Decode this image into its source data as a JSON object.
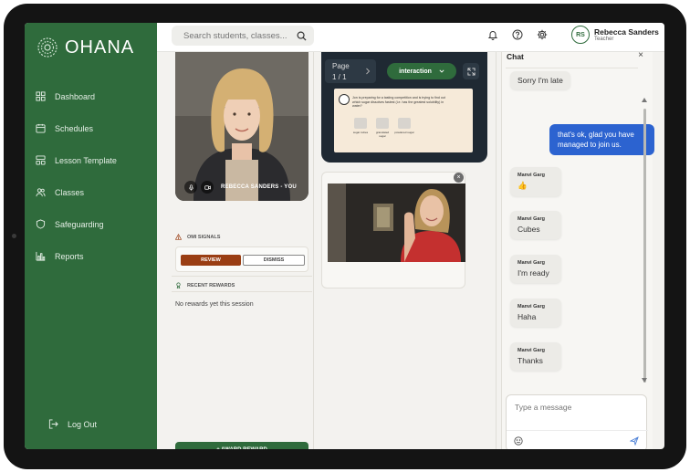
{
  "brand": {
    "name": "OHANA",
    "color": "#2f6b3c"
  },
  "sidebar": {
    "items": [
      {
        "label": "Dashboard",
        "icon": "grid-icon"
      },
      {
        "label": "Schedules",
        "icon": "calendar-icon"
      },
      {
        "label": "Lesson Template",
        "icon": "template-icon"
      },
      {
        "label": "Classes",
        "icon": "users-icon"
      },
      {
        "label": "Safeguarding",
        "icon": "shield-icon"
      },
      {
        "label": "Reports",
        "icon": "bar-chart-icon"
      }
    ],
    "logout_label": "Log Out"
  },
  "header": {
    "search_placeholder": "Search students, classes...",
    "user": {
      "initials": "RS",
      "name": "Rebecca Sanders",
      "role": "Teacher"
    }
  },
  "self_video": {
    "label": "REBECCA SANDERS - YOU"
  },
  "signals": {
    "title": "OMI SIGNALS",
    "review_label": "REVIEW",
    "dismiss_label": "DISMISS"
  },
  "rewards": {
    "title": "RECENT REWARDS",
    "empty_text": "No rewards yet this session",
    "award_label": "+ AWARD REWARD"
  },
  "document": {
    "page_label": "Page",
    "page_value": "1 / 1",
    "mode_label": "interaction",
    "question": "Jon is preparing for a tasting competition and is trying to find out which sugar dissolves fastest (i.e. has the greatest solubility) in water?",
    "options": [
      "sugar cubes",
      "granulated sugar",
      "powdered sugar"
    ]
  },
  "chat": {
    "title": "Chat",
    "messages": [
      {
        "type": "in",
        "sender": "",
        "text": "Sorry I'm late"
      },
      {
        "type": "out",
        "text": "that's ok, glad you have managed to join us."
      },
      {
        "type": "in",
        "sender": "Manvi Garg",
        "text": "👍"
      },
      {
        "type": "in",
        "sender": "Manvi Garg",
        "text": "Cubes"
      },
      {
        "type": "in",
        "sender": "Manvi Garg",
        "text": "I'm ready"
      },
      {
        "type": "in",
        "sender": "Manvi Garg",
        "text": "Haha"
      },
      {
        "type": "in",
        "sender": "Manvi Garg",
        "text": "Thanks"
      }
    ],
    "input_placeholder": "Type a message"
  }
}
